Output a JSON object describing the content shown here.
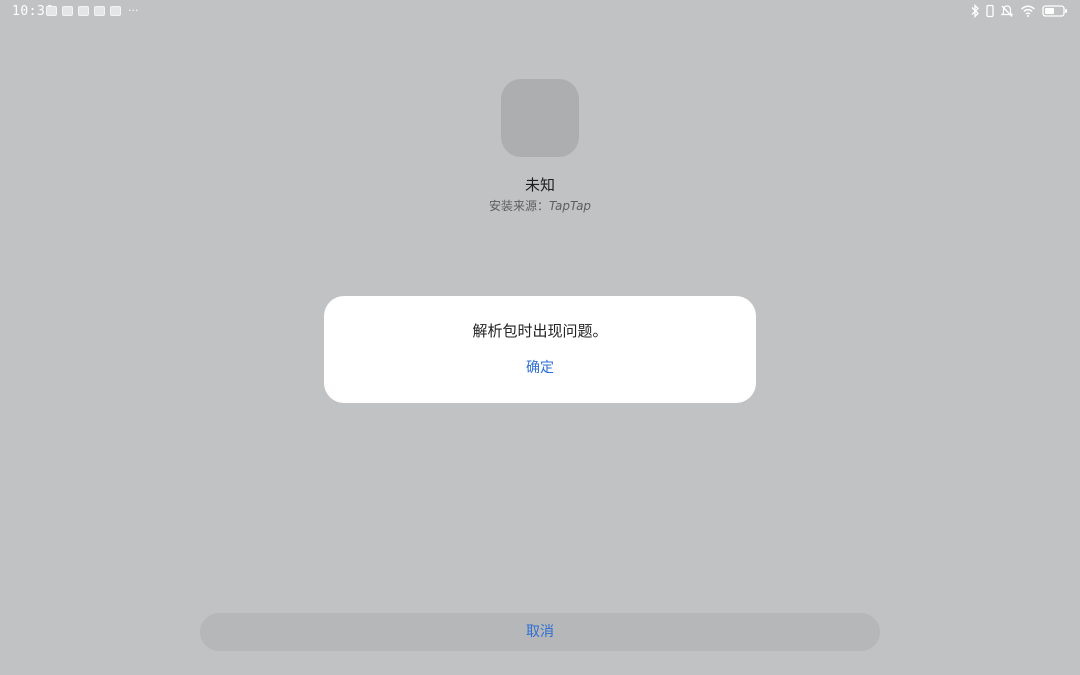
{
  "status_bar": {
    "time": "10:36",
    "notification_icons": [
      "notification-icon",
      "notification-icon",
      "notification-icon",
      "notification-icon",
      "notification-icon"
    ],
    "more": "···",
    "system_icons": [
      "bluetooth-icon",
      "vibrate-icon",
      "mute-icon",
      "wifi-icon",
      "battery-icon"
    ]
  },
  "app_info": {
    "name": "未知",
    "source_label": "安装来源：",
    "source_value": "TapTap"
  },
  "dialog": {
    "message": "解析包时出现问题。",
    "confirm_label": "确定"
  },
  "footer": {
    "cancel_label": "取消"
  },
  "colors": {
    "background": "#c1c2c4",
    "accent": "#2f6ed3",
    "dialog": "#ffffff"
  }
}
